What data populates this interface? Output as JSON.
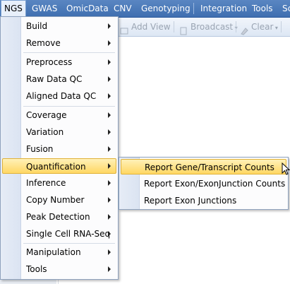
{
  "menubar": {
    "items": [
      "NGS",
      "GWAS",
      "OmicData",
      "CNV",
      "Genotyping",
      "Integration",
      "Tools",
      "Sc"
    ]
  },
  "toolbar": {
    "add_view": "Add View",
    "broadcast": "Broadcast",
    "clear": "Clear"
  },
  "ngs_menu": {
    "items": [
      {
        "label": "Build"
      },
      {
        "label": "Remove"
      },
      {
        "label": "Preprocess"
      },
      {
        "label": "Raw Data QC"
      },
      {
        "label": "Aligned Data QC"
      },
      {
        "label": "Coverage"
      },
      {
        "label": "Variation"
      },
      {
        "label": "Fusion"
      },
      {
        "label": "Quantification"
      },
      {
        "label": "Inference"
      },
      {
        "label": "Copy Number"
      },
      {
        "label": "Peak Detection"
      },
      {
        "label": "Single Cell RNA-Seq"
      },
      {
        "label": "Manipulation"
      },
      {
        "label": "Tools"
      }
    ]
  },
  "quantification_submenu": {
    "items": [
      {
        "label": "Report Gene/Transcript Counts"
      },
      {
        "label": "Report Exon/ExonJunction Counts"
      },
      {
        "label": "Report Exon Junctions"
      }
    ]
  },
  "colors": {
    "menubar": "#4a7abb",
    "highlight": "#ffd763"
  }
}
